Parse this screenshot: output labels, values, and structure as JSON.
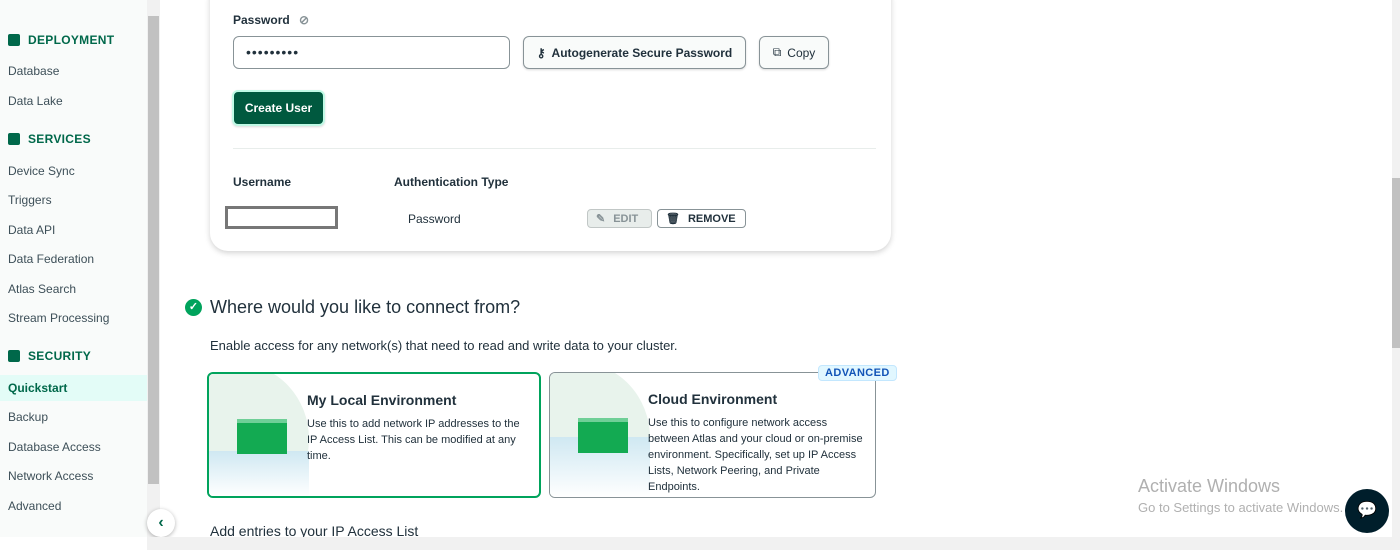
{
  "sidebar": {
    "sections": [
      {
        "label": "DEPLOYMENT",
        "icon": "database-icon"
      },
      {
        "label": "SERVICES",
        "icon": "services-icon"
      },
      {
        "label": "SECURITY",
        "icon": "lock-icon"
      }
    ],
    "deployment": [
      "Database",
      "Data Lake"
    ],
    "services": [
      "Device Sync",
      "Triggers",
      "Data API",
      "Data Federation",
      "Atlas Search",
      "Stream Processing"
    ],
    "security": [
      "Quickstart",
      "Backup",
      "Database Access",
      "Network Access",
      "Advanced"
    ],
    "active": "Quickstart"
  },
  "user_form": {
    "password_label": "Password",
    "password_value": "•••••••••",
    "autogenerate_label": "Autogenerate Secure Password",
    "copy_label": "Copy",
    "create_label": "Create User",
    "col_username": "Username",
    "col_auth": "Authentication Type",
    "row_auth": "Password",
    "edit_label": "EDIT",
    "remove_label": "REMOVE"
  },
  "connect": {
    "title": "Where would you like to connect from?",
    "subtitle": "Enable access for any network(s) that need to read and write data to your cluster.",
    "local": {
      "title": "My Local Environment",
      "desc": "Use this to add network IP addresses to the IP Access List. This can be modified at any time."
    },
    "cloud": {
      "title": "Cloud Environment",
      "badge": "ADVANCED",
      "desc": "Use this to configure network access between Atlas and your cloud or on-premise environment. Specifically, set up IP Access Lists, Network Peering, and Private Endpoints."
    },
    "ip_heading": "Add entries to your IP Access List"
  },
  "watermark": {
    "title": "Activate Windows",
    "sub": "Go to Settings to activate Windows."
  },
  "colors": {
    "primary": "#00593f",
    "accent": "#00a35c",
    "badge": "#1254b7"
  }
}
